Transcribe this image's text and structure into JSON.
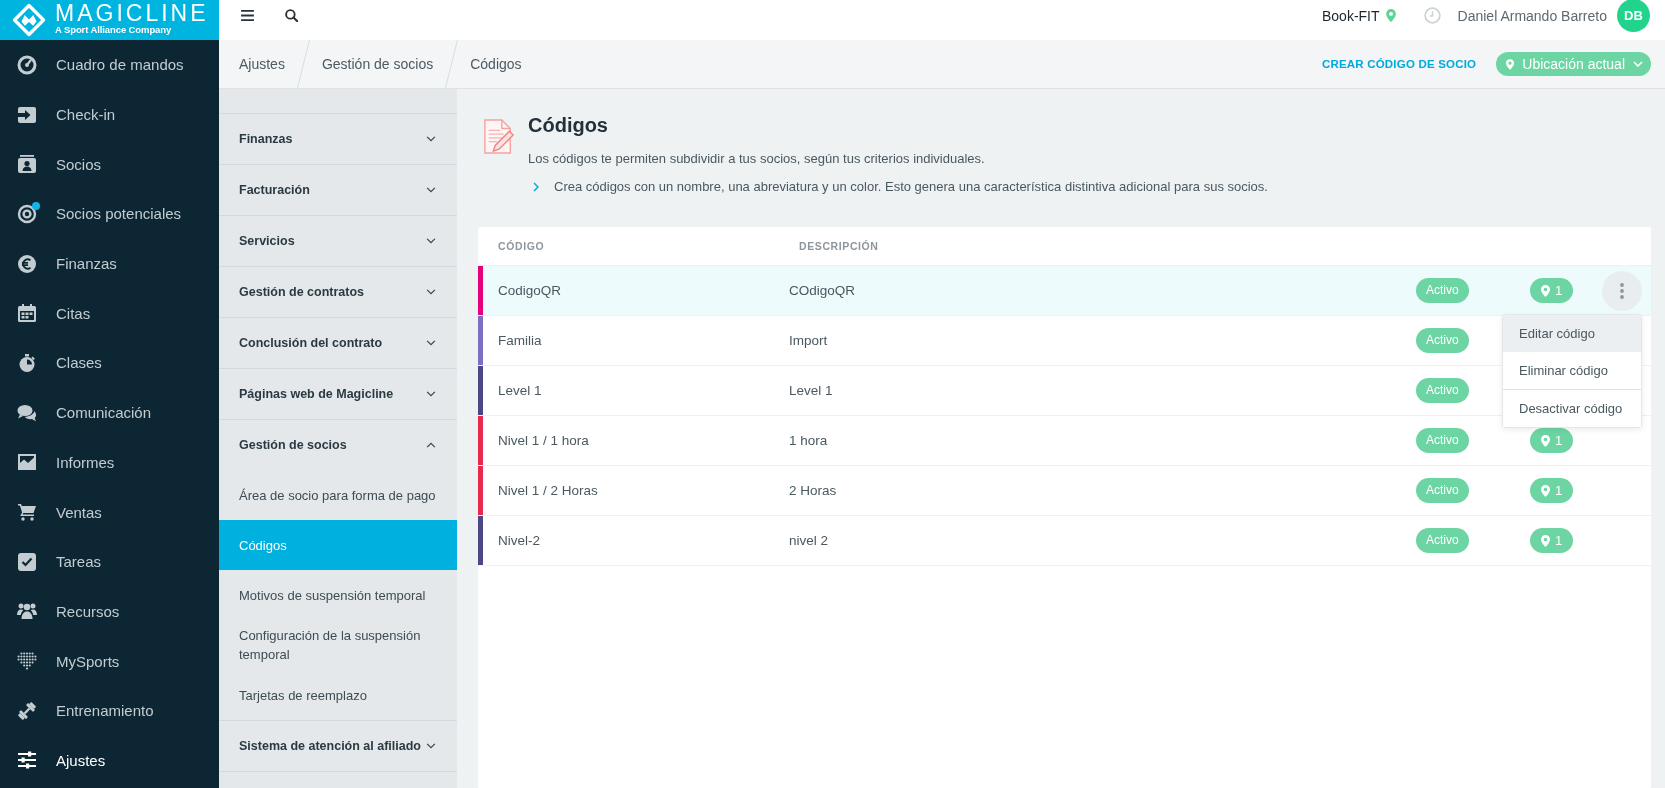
{
  "logo": {
    "name": "MAGICLINE",
    "tagline": "A Sport Alliance Company"
  },
  "nav": {
    "items": [
      {
        "label": "Cuadro de mandos",
        "selected": false,
        "notification": false
      },
      {
        "label": "Check-in",
        "selected": false,
        "notification": false
      },
      {
        "label": "Socios",
        "selected": false,
        "notification": false
      },
      {
        "label": "Socios potenciales",
        "selected": false,
        "notification": true
      },
      {
        "label": "Finanzas",
        "selected": false,
        "notification": false
      },
      {
        "label": "Citas",
        "selected": false,
        "notification": false
      },
      {
        "label": "Clases",
        "selected": false,
        "notification": false
      },
      {
        "label": "Comunicación",
        "selected": false,
        "notification": false
      },
      {
        "label": "Informes",
        "selected": false,
        "notification": false
      },
      {
        "label": "Ventas",
        "selected": false,
        "notification": false
      },
      {
        "label": "Tareas",
        "selected": false,
        "notification": false
      },
      {
        "label": "Recursos",
        "selected": false,
        "notification": false
      },
      {
        "label": "MySports",
        "selected": false,
        "notification": false
      },
      {
        "label": "Entrenamiento",
        "selected": false,
        "notification": false
      },
      {
        "label": "Ajustes",
        "selected": true,
        "notification": false
      }
    ]
  },
  "topbar": {
    "studio": "Book-FIT",
    "user": "Daniel Armando Barreto",
    "avatar_initials": "DB"
  },
  "breadcrumbs": [
    "Ajustes",
    "Gestión de socios",
    "Códigos"
  ],
  "actions": {
    "create_link": "CREAR CÓDIGO DE SOCIO",
    "location_button": "Ubicación actual"
  },
  "settings_menu": {
    "sections": [
      {
        "label": "Finanzas",
        "expanded": false
      },
      {
        "label": "Facturación",
        "expanded": false
      },
      {
        "label": "Servicios",
        "expanded": false
      },
      {
        "label": "Gestión de contratos",
        "expanded": false
      },
      {
        "label": "Conclusión del contrato",
        "expanded": false
      },
      {
        "label": "Páginas web de Magicline",
        "expanded": false
      },
      {
        "label": "Gestión de socios",
        "expanded": true,
        "children": [
          {
            "label": "Área de socio para forma de pago",
            "selected": false
          },
          {
            "label": "Códigos",
            "selected": true
          },
          {
            "label": "Motivos de suspensión temporal",
            "selected": false
          },
          {
            "label": "Configuración de la suspensión temporal",
            "selected": false
          },
          {
            "label": "Tarjetas de reemplazo",
            "selected": false
          }
        ]
      },
      {
        "label": "Sistema de atención al afiliado",
        "expanded": false
      }
    ]
  },
  "page_header": {
    "title": "Códigos",
    "description": "Los códigos te permiten subdividir a tus socios, según tus criterios individuales.",
    "hint": "Crea códigos con un nombre, una abreviatura y un color. Esto genera una característica distintiva adicional para sus socios."
  },
  "table": {
    "columns": [
      "CÓDIGO",
      "DESCRIPCIÓN"
    ],
    "rows": [
      {
        "code": "CodigoQR",
        "description": "COdigoQR",
        "color": "#e5007d",
        "status": "Activo",
        "locations": "1",
        "menu_open": true
      },
      {
        "code": "Familia",
        "description": "Import",
        "color": "#7b6fc4",
        "status": "Activo",
        "menu_open": false
      },
      {
        "code": "Level 1",
        "description": "Level 1",
        "color": "#4b4784",
        "status": "Activo",
        "menu_open": false
      },
      {
        "code": "Nivel 1 / 1 hora",
        "description": "1 hora",
        "color": "#e8294c",
        "status": "Activo",
        "locations": "1",
        "menu_open": false
      },
      {
        "code": "Nivel 1 / 2 Horas",
        "description": "2 Horas",
        "color": "#e8294c",
        "status": "Activo",
        "locations": "1",
        "menu_open": false
      },
      {
        "code": "Nivel-2",
        "description": "nivel 2",
        "color": "#4b4784",
        "status": "Activo",
        "locations": "1",
        "menu_open": false
      }
    ]
  },
  "row_menu": {
    "groups": [
      [
        {
          "label": "Editar código",
          "highlighted": true
        },
        {
          "label": "Eliminar código",
          "highlighted": false
        }
      ],
      [
        {
          "label": "Desactivar código",
          "highlighted": false
        }
      ]
    ]
  }
}
